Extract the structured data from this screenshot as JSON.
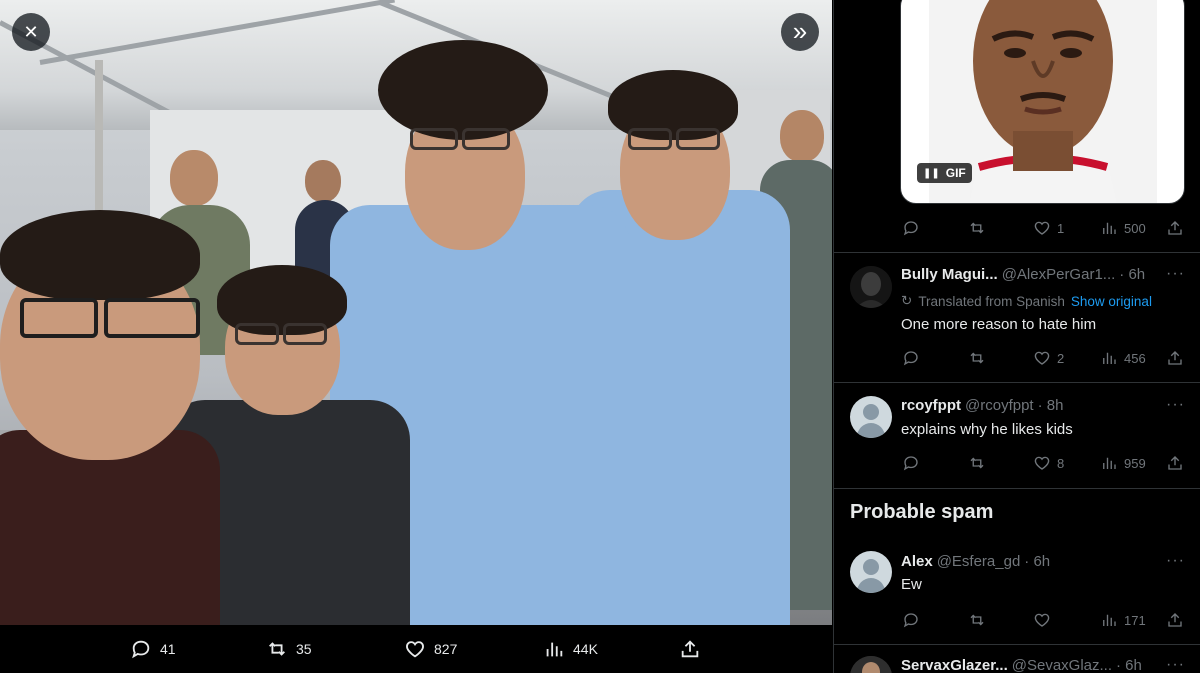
{
  "media": {
    "close_label": "✕",
    "expand_label": "»",
    "actions": {
      "replies": "41",
      "reposts": "35",
      "likes": "827",
      "views": "44K"
    }
  },
  "gif_tweet": {
    "badge": "GIF",
    "stats": {
      "replies": "",
      "reposts": "",
      "likes": "1",
      "views": "500"
    }
  },
  "replies": [
    {
      "name": "Bully Magui...",
      "handle": "@AlexPerGar1...",
      "time": "· 6h",
      "translated_label": "Translated from Spanish",
      "show_original": "Show original",
      "text": "One more reason to hate him",
      "stats": {
        "replies": "",
        "reposts": "",
        "likes": "2",
        "views": "456"
      }
    },
    {
      "name": "rcoyfppt",
      "handle": "@rcoyfppt",
      "time": "· 8h",
      "text": "explains why he likes kids",
      "stats": {
        "replies": "",
        "reposts": "",
        "likes": "8",
        "views": "959"
      }
    }
  ],
  "spam_section": {
    "title": "Probable spam",
    "replies": [
      {
        "name": "Alex",
        "handle": "@Esfera_gd",
        "time": "· 6h",
        "text": "Ew",
        "stats": {
          "replies": "",
          "reposts": "",
          "likes": "",
          "views": "171"
        }
      },
      {
        "name": "ServaxGlazer...",
        "handle": "@SevaxGlaz...",
        "time": "· 6h"
      }
    ]
  },
  "more_label": "···"
}
